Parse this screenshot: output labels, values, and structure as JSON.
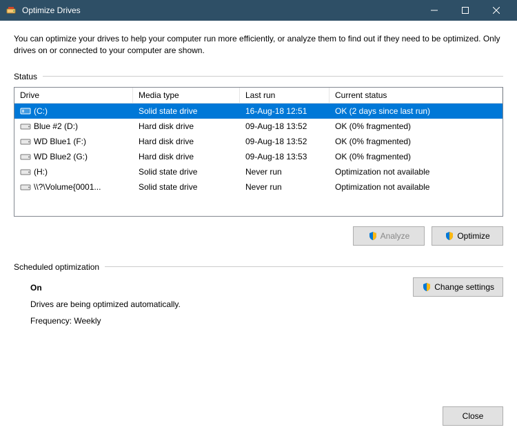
{
  "window": {
    "title": "Optimize Drives"
  },
  "intro": "You can optimize your drives to help your computer run more efficiently, or analyze them to find out if they need to be optimized. Only drives on or connected to your computer are shown.",
  "status_label": "Status",
  "columns": {
    "drive": "Drive",
    "media": "Media type",
    "last": "Last run",
    "status": "Current status"
  },
  "drives": [
    {
      "name": "(C:)",
      "media": "Solid state drive",
      "last": "16-Aug-18 12:51",
      "status": "OK (2 days since last run)",
      "selected": true,
      "type": "ssd"
    },
    {
      "name": "Blue #2 (D:)",
      "media": "Hard disk drive",
      "last": "09-Aug-18 13:52",
      "status": "OK (0% fragmented)",
      "selected": false,
      "type": "hdd"
    },
    {
      "name": "WD Blue1 (F:)",
      "media": "Hard disk drive",
      "last": "09-Aug-18 13:52",
      "status": "OK (0% fragmented)",
      "selected": false,
      "type": "hdd"
    },
    {
      "name": "WD Blue2 (G:)",
      "media": "Hard disk drive",
      "last": "09-Aug-18 13:53",
      "status": "OK (0% fragmented)",
      "selected": false,
      "type": "hdd"
    },
    {
      "name": "(H:)",
      "media": "Solid state drive",
      "last": "Never run",
      "status": "Optimization not available",
      "selected": false,
      "type": "hdd"
    },
    {
      "name": "\\\\?\\Volume{0001...",
      "media": "Solid state drive",
      "last": "Never run",
      "status": "Optimization not available",
      "selected": false,
      "type": "hdd"
    }
  ],
  "buttons": {
    "analyze": "Analyze",
    "optimize": "Optimize",
    "change_settings": "Change settings",
    "close": "Close"
  },
  "schedule": {
    "label": "Scheduled optimization",
    "state": "On",
    "desc": "Drives are being optimized automatically.",
    "freq": "Frequency: Weekly"
  }
}
